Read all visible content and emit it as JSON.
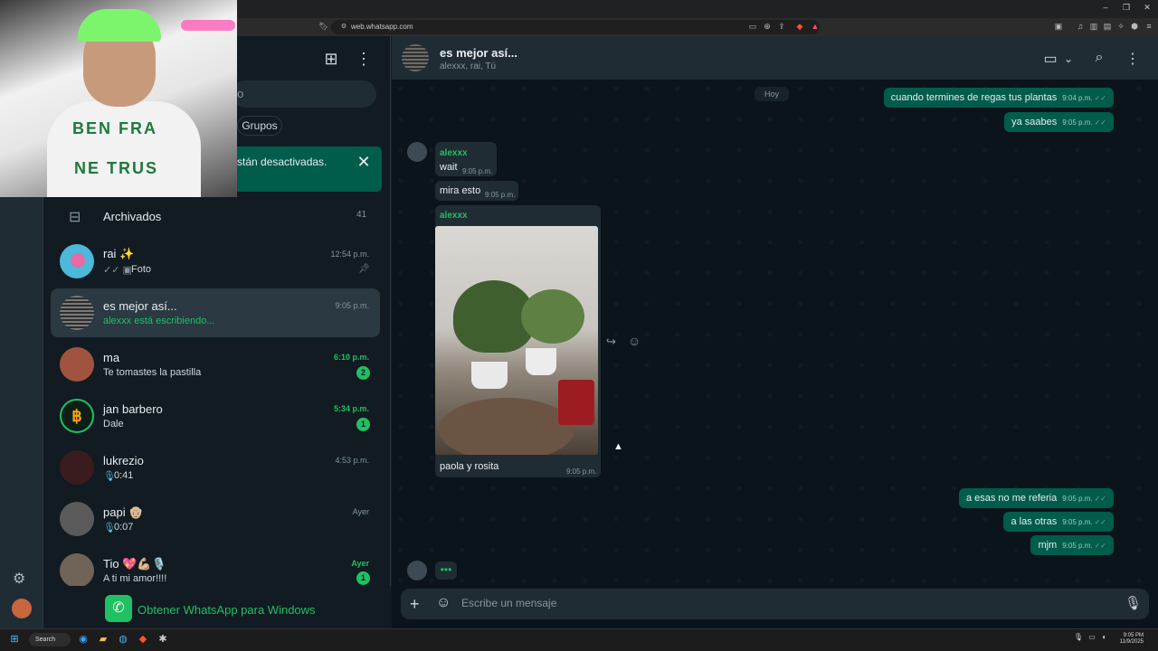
{
  "browser": {
    "url": "web.whatsapp.com",
    "window_buttons": [
      "–",
      "❐",
      "✕"
    ]
  },
  "sidebar": {
    "search_placeholder": "o",
    "chip_groups": "Grupos",
    "notification_text": "stán desactivadas.",
    "archived_label": "Archivados",
    "archived_count": "41",
    "chats": [
      {
        "name": "rai ✨",
        "preview": "Foto",
        "time": "12:54 p.m.",
        "pinned": true
      },
      {
        "name": "es mejor así...",
        "preview": "alexxx está escribiendo...",
        "time": "9:05 p.m."
      },
      {
        "name": "ma",
        "preview": "Te tomastes la pastilla",
        "time": "6:10 p.m.",
        "badge": "2"
      },
      {
        "name": "jan barbero",
        "preview": "Dale",
        "time": "5:34 p.m.",
        "badge": "1"
      },
      {
        "name": "lukrezio",
        "preview": "0:41",
        "time": "4:53 p.m."
      },
      {
        "name": "papi 👴🏼",
        "preview": "0:07",
        "time": "Ayer"
      },
      {
        "name": "Tio 💖💪🏼🎙️",
        "preview": "A ti mi amor!!!!",
        "time": "Ayer",
        "badge": "1"
      }
    ],
    "get_app_label": "Obtener WhatsApp para Windows"
  },
  "webcam": {
    "shirt_line1": "BEN FRA",
    "shirt_line2": "NE TRUS"
  },
  "chat": {
    "title": "es mejor así...",
    "subtitle": "alexxx, rai, Tú",
    "date_chip": "Hoy",
    "outgoing_top": [
      {
        "text": "cuando termines de regas tus plantas",
        "time": "9:04 p.m."
      },
      {
        "text": "ya saabes",
        "time": "9:05 p.m."
      }
    ],
    "incoming": [
      {
        "sender": "alexxx",
        "text": "wait",
        "time": "9:05 p.m."
      },
      {
        "text": "mira esto",
        "time": "9:05 p.m."
      }
    ],
    "photo_message": {
      "sender": "alexxx",
      "caption": "paola y rosita",
      "time": "9:05 p.m."
    },
    "outgoing_bottom": [
      {
        "text": "a esas no me referia",
        "time": "9:05 p.m."
      },
      {
        "text": "a las otras",
        "time": "9:05 p.m."
      },
      {
        "text": "mjm",
        "time": "9:05 p.m."
      }
    ],
    "composer_placeholder": "Escribe un mensaje"
  },
  "taskbar": {
    "search_label": "Search",
    "time": "9:05 PM",
    "date": "11/9/2025"
  },
  "colors": {
    "accent": "#21c063",
    "outgoing_bubble": "#005c4b",
    "incoming_bubble": "#202c33",
    "background": "#0b141a"
  }
}
